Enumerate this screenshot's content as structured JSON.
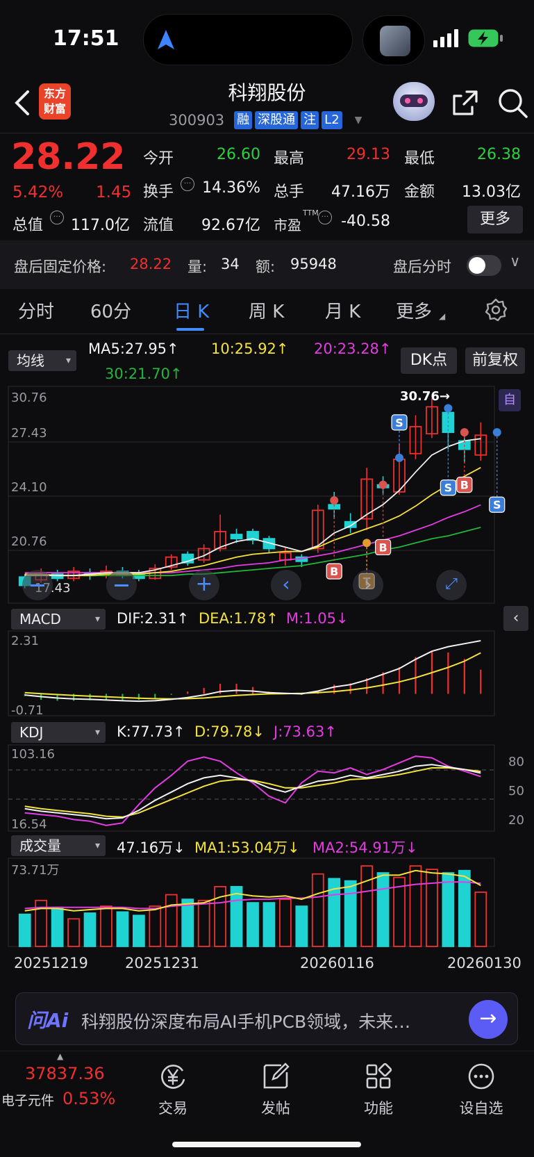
{
  "status_bar": {
    "time": "17:51"
  },
  "header": {
    "title": "科翔股份",
    "code": "300903",
    "tags": [
      "融",
      "深股通",
      "注",
      "L2"
    ],
    "logo_line1": "东方",
    "logo_line2": "财富"
  },
  "quote": {
    "price": "28.22",
    "change_pct": "5.42%",
    "change_amt": "1.45",
    "fields": {
      "open_label": "今开",
      "open": "26.60",
      "high_label": "最高",
      "high": "29.13",
      "low_label": "最低",
      "low": "26.38",
      "turnover_label": "换手",
      "turnover": "14.36%",
      "volume_label": "总手",
      "volume": "47.16万",
      "amount_label": "金额",
      "amount": "13.03亿",
      "mktcap_label": "总值",
      "mktcap": "117.0亿",
      "float_label": "流值",
      "float": "92.67亿",
      "pe_label": "市盈",
      "pe_sup": "TTM",
      "pe": "-40.58"
    },
    "more_label": "更多"
  },
  "after_hours": {
    "price_label": "盘后固定价格:",
    "price": "28.22",
    "vol_label": "量:",
    "vol": "34",
    "amt_label": "额:",
    "amt": "95948",
    "timeshare_label": "盘后分时"
  },
  "period_tabs": [
    "分时",
    "60分",
    "日 K",
    "周 K",
    "月 K",
    "更多"
  ],
  "kline": {
    "ma_selector": "均线",
    "ma5": "MA5:27.95",
    "ma10": "10:25.92",
    "ma20": "20:23.28",
    "ma30": "30:21.70",
    "dk_label": "DK点",
    "adjust_label": "前复权",
    "ymax": "30.76",
    "y2": "27.43",
    "y3": "24.10",
    "y4": "20.76",
    "ymin": "17.43",
    "high_marker": "30.76→",
    "self_label": "自"
  },
  "macd": {
    "selector": "MACD",
    "dif": "DIF:2.31",
    "dea": "DEA:1.78",
    "m": "M:1.05",
    "ymax": "2.31",
    "ymin": "-0.71"
  },
  "kdj": {
    "selector": "KDJ",
    "k": "K:77.73",
    "d": "D:79.78",
    "j": "J:73.63",
    "ymax": "103.16",
    "ymin": "16.54",
    "r80": "80",
    "r50": "50",
    "r20": "20"
  },
  "volume": {
    "selector": "成交量",
    "vol": "47.16万",
    "ma1": "MA1:53.04万",
    "ma2": "MA2:54.91万",
    "ymax": "73.71万"
  },
  "dates": [
    "20251219",
    "20251231",
    "20260116",
    "20260130"
  ],
  "ai_bar": {
    "logo": "问Ai",
    "text": "科翔股份深度布局AI手机PCB领域，未来…"
  },
  "nav": {
    "index_value": "37837.36",
    "index_name": "电子元件",
    "index_pct": "0.53%",
    "items": [
      "交易",
      "发帖",
      "功能",
      "设自选"
    ]
  },
  "chart_data": {
    "type": "candlestick",
    "candles": [
      {
        "o": 18.2,
        "c": 17.6,
        "h": 18.4,
        "l": 17.4
      },
      {
        "o": 18.0,
        "c": 18.5,
        "h": 18.8,
        "l": 17.8
      },
      {
        "o": 18.4,
        "c": 18.1,
        "h": 18.7,
        "l": 17.9
      },
      {
        "o": 18.1,
        "c": 18.6,
        "h": 18.9,
        "l": 17.9
      },
      {
        "o": 18.5,
        "c": 18.3,
        "h": 18.8,
        "l": 18.0
      },
      {
        "o": 18.3,
        "c": 18.6,
        "h": 19.0,
        "l": 18.1
      },
      {
        "o": 18.6,
        "c": 18.3,
        "h": 18.9,
        "l": 18.1
      },
      {
        "o": 18.4,
        "c": 18.1,
        "h": 18.7,
        "l": 17.9
      },
      {
        "o": 18.1,
        "c": 18.8,
        "h": 19.1,
        "l": 18.0
      },
      {
        "o": 18.9,
        "c": 19.6,
        "h": 19.8,
        "l": 18.7
      },
      {
        "o": 19.8,
        "c": 19.2,
        "h": 20.0,
        "l": 19.0
      },
      {
        "o": 19.4,
        "c": 20.2,
        "h": 20.5,
        "l": 19.2
      },
      {
        "o": 20.2,
        "c": 21.4,
        "h": 22.6,
        "l": 20.0
      },
      {
        "o": 21.2,
        "c": 20.9,
        "h": 21.6,
        "l": 20.6
      },
      {
        "o": 21.4,
        "c": 20.8,
        "h": 21.6,
        "l": 20.5
      },
      {
        "o": 20.9,
        "c": 20.2,
        "h": 21.1,
        "l": 19.9
      },
      {
        "o": 19.4,
        "c": 19.9,
        "h": 20.3,
        "l": 19.0
      },
      {
        "o": 19.6,
        "c": 19.3,
        "h": 19.8,
        "l": 18.9
      },
      {
        "o": 20.2,
        "c": 22.9,
        "h": 23.3,
        "l": 19.9
      },
      {
        "o": 23.3,
        "c": 23.0,
        "h": 24.2,
        "l": 22.3
      },
      {
        "o": 22.1,
        "c": 21.7,
        "h": 22.7,
        "l": 21.3
      },
      {
        "o": 22.3,
        "c": 25.1,
        "h": 25.9,
        "l": 21.5
      },
      {
        "o": 24.7,
        "c": 24.5,
        "h": 25.3,
        "l": 24.0
      },
      {
        "o": 24.2,
        "c": 26.5,
        "h": 27.6,
        "l": 24.0
      },
      {
        "o": 26.9,
        "c": 28.8,
        "h": 29.6,
        "l": 26.5
      },
      {
        "o": 28.3,
        "c": 30.2,
        "h": 30.8,
        "l": 28.0
      },
      {
        "o": 29.8,
        "c": 28.4,
        "h": 30.1,
        "l": 27.2
      },
      {
        "o": 27.8,
        "c": 27.2,
        "h": 28.4,
        "l": 26.3
      },
      {
        "o": 26.8,
        "c": 28.2,
        "h": 29.1,
        "l": 26.4
      }
    ],
    "ma5": [
      18.3,
      18.3,
      18.3,
      18.3,
      18.4,
      18.5,
      18.5,
      18.5,
      18.7,
      19.0,
      19.3,
      19.7,
      20.3,
      20.7,
      20.9,
      20.6,
      20.3,
      20.0,
      20.4,
      21.3,
      21.8,
      22.6,
      23.3,
      24.3,
      25.6,
      26.8,
      27.4,
      27.8,
      27.95
    ],
    "ma10": [
      18.4,
      18.4,
      18.3,
      18.3,
      18.3,
      18.4,
      18.4,
      18.4,
      18.5,
      18.6,
      18.8,
      19.0,
      19.3,
      19.6,
      19.8,
      19.9,
      20.0,
      20.0,
      20.3,
      20.8,
      21.2,
      21.6,
      22.0,
      22.5,
      23.2,
      24.0,
      24.7,
      25.3,
      25.92
    ],
    "ma20": [
      18.5,
      18.5,
      18.5,
      18.5,
      18.5,
      18.5,
      18.5,
      18.5,
      18.5,
      18.5,
      18.6,
      18.7,
      18.8,
      19.0,
      19.1,
      19.2,
      19.4,
      19.5,
      19.7,
      19.9,
      20.2,
      20.5,
      20.8,
      21.1,
      21.5,
      21.9,
      22.4,
      22.8,
      23.28
    ],
    "ma30": [
      18.3,
      18.3,
      18.3,
      18.3,
      18.3,
      18.3,
      18.3,
      18.3,
      18.3,
      18.3,
      18.4,
      18.4,
      18.5,
      18.6,
      18.7,
      18.8,
      18.9,
      19.0,
      19.2,
      19.4,
      19.6,
      19.8,
      20.1,
      20.3,
      20.6,
      20.9,
      21.1,
      21.4,
      21.7
    ],
    "macd_dif": [
      -0.05,
      -0.12,
      -0.18,
      -0.22,
      -0.24,
      -0.27,
      -0.3,
      -0.32,
      -0.3,
      -0.24,
      -0.16,
      -0.05,
      0.1,
      0.15,
      0.12,
      0.05,
      0.02,
      0.0,
      0.12,
      0.3,
      0.4,
      0.6,
      0.85,
      1.1,
      1.5,
      1.85,
      2.05,
      2.18,
      2.31
    ],
    "macd_dea": [
      0.05,
      0.01,
      -0.03,
      -0.07,
      -0.1,
      -0.13,
      -0.16,
      -0.19,
      -0.21,
      -0.22,
      -0.21,
      -0.18,
      -0.12,
      -0.07,
      -0.03,
      0.0,
      0.01,
      0.02,
      0.05,
      0.1,
      0.17,
      0.26,
      0.38,
      0.52,
      0.7,
      0.92,
      1.15,
      1.42,
      1.78
    ],
    "macd_m": [
      -0.1,
      -0.26,
      -0.3,
      -0.3,
      -0.28,
      -0.28,
      -0.28,
      -0.26,
      -0.18,
      -0.04,
      0.1,
      0.26,
      0.44,
      0.44,
      0.3,
      0.1,
      0.02,
      -0.04,
      0.14,
      0.4,
      0.46,
      0.68,
      0.94,
      1.16,
      1.6,
      1.86,
      1.8,
      1.52,
      1.05
    ],
    "kdj_k": [
      35,
      32,
      30,
      28,
      26,
      23,
      24,
      33,
      45,
      55,
      65,
      72,
      75,
      72,
      68,
      60,
      55,
      62,
      68,
      70,
      75,
      72,
      76,
      80,
      86,
      88,
      85,
      82,
      77.73
    ],
    "kdj_d": [
      38,
      35,
      33,
      31,
      29,
      26,
      25,
      30,
      38,
      46,
      54,
      62,
      68,
      70,
      69,
      65,
      60,
      60,
      63,
      66,
      70,
      71,
      73,
      76,
      80,
      84,
      84,
      82,
      79.78
    ],
    "kdj_j": [
      30,
      28,
      26,
      22,
      20,
      15,
      18,
      40,
      60,
      75,
      92,
      97,
      92,
      78,
      66,
      50,
      42,
      66,
      80,
      78,
      84,
      76,
      82,
      90,
      98,
      96,
      86,
      80,
      73.63
    ],
    "volume": [
      28,
      40,
      34,
      24,
      29,
      35,
      30,
      27,
      35,
      45,
      41,
      40,
      52,
      52,
      38,
      38,
      41,
      35,
      63,
      59,
      57,
      70,
      64,
      60,
      70,
      67,
      64,
      66,
      47.16
    ],
    "volume_ma1": [
      31,
      33,
      33,
      31,
      32,
      33,
      33,
      31,
      32,
      36,
      37,
      38,
      43,
      46,
      44,
      43,
      44,
      41,
      46,
      50,
      52,
      57,
      62,
      62,
      66,
      64,
      63,
      61,
      53.04
    ],
    "volume_ma2": [
      33,
      34,
      34,
      34,
      34,
      34,
      34,
      33,
      33,
      35,
      36,
      37,
      38,
      40,
      41,
      41,
      42,
      42,
      43,
      45,
      46,
      48,
      50,
      52,
      54,
      55,
      56,
      56,
      54.91
    ],
    "kline_ylim": [
      17.43,
      30.76
    ],
    "macd_ylim": [
      -0.71,
      2.31
    ],
    "kdj_ylim": [
      16.54,
      103.16
    ],
    "volume_ylim": [
      0,
      73.71
    ]
  }
}
